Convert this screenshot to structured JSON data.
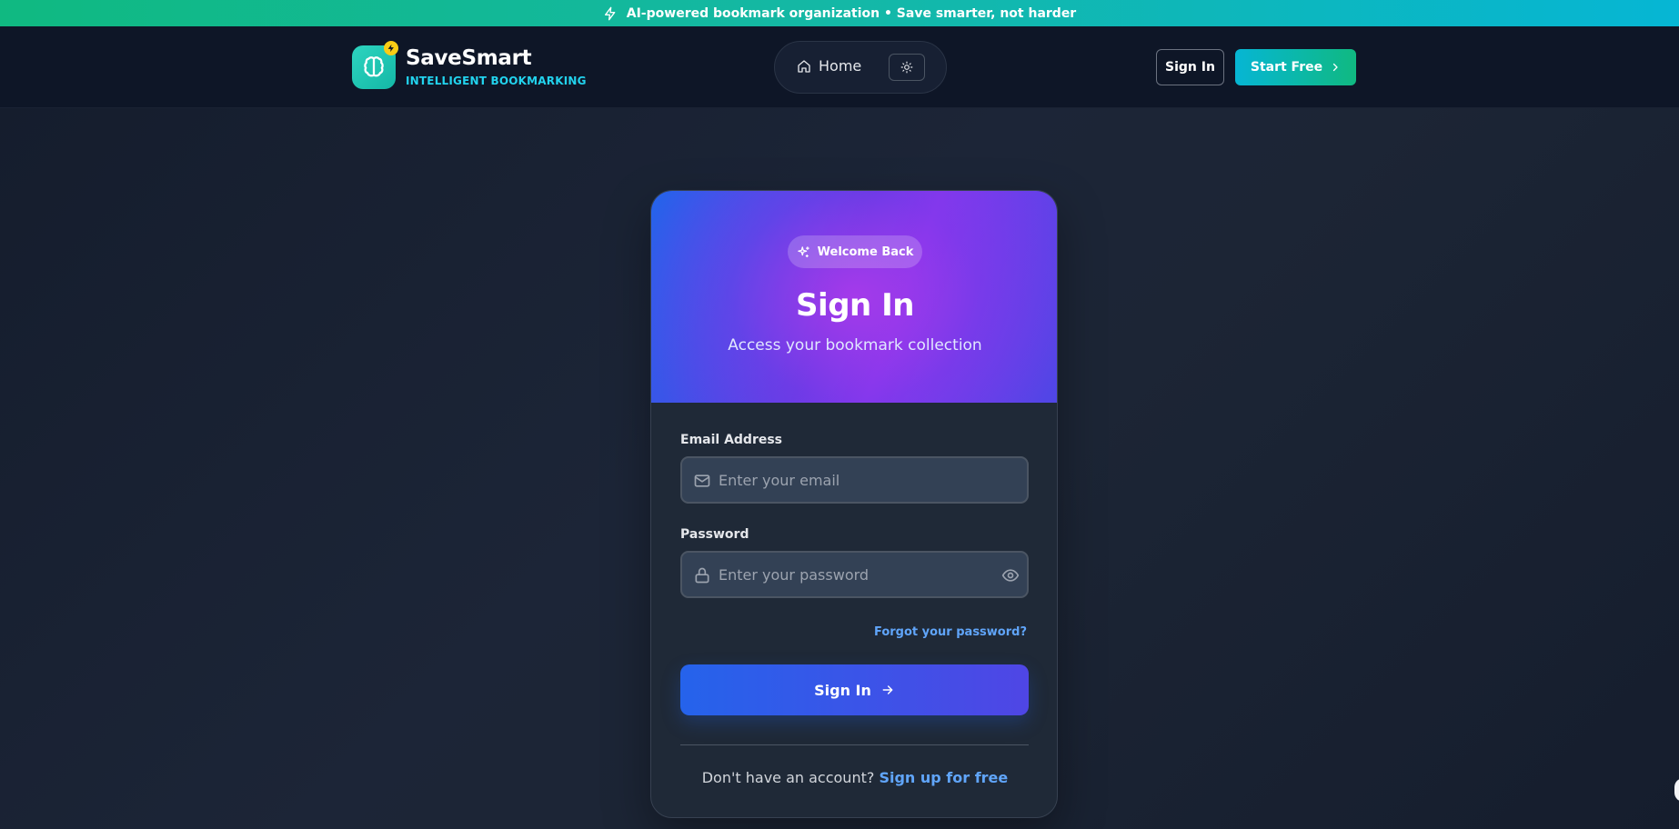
{
  "banner": {
    "icon": "lightning-icon",
    "text": "AI-powered bookmark organization • Save smarter, not harder"
  },
  "header": {
    "logo_icon": "brain-icon",
    "logo_badge_icon": "lightning-icon",
    "brand_name": "SaveSmart",
    "brand_tagline": "INTELLIGENT BOOKMARKING",
    "nav": {
      "home_icon": "home-icon",
      "home_label": "Home",
      "theme_icon": "sun-icon"
    },
    "signin_label": "Sign In",
    "start_label": "Start Free",
    "start_icon": "chevron-right-icon"
  },
  "card": {
    "badge_icon": "sparkles-icon",
    "badge_label": "Welcome Back",
    "title": "Sign In",
    "subtitle": "Access your bookmark collection",
    "email": {
      "label": "Email Address",
      "icon": "mail-icon",
      "placeholder": "Enter your email",
      "value": ""
    },
    "password": {
      "label": "Password",
      "icon": "lock-icon",
      "toggle_icon": "eye-icon",
      "placeholder": "Enter your password",
      "value": ""
    },
    "forgot_label": "Forgot your password?",
    "submit_label": "Sign In",
    "submit_icon": "arrow-right-icon",
    "footer_text": "Don't have an account?",
    "footer_link": "Sign up for free"
  },
  "colors": {
    "accent_teal": "#14b8a6",
    "accent_cyan": "#22d3ee",
    "accent_blue": "#2563eb",
    "accent_purple": "#9333ea",
    "link_blue": "#60a5fa",
    "badge_yellow": "#facc15"
  }
}
